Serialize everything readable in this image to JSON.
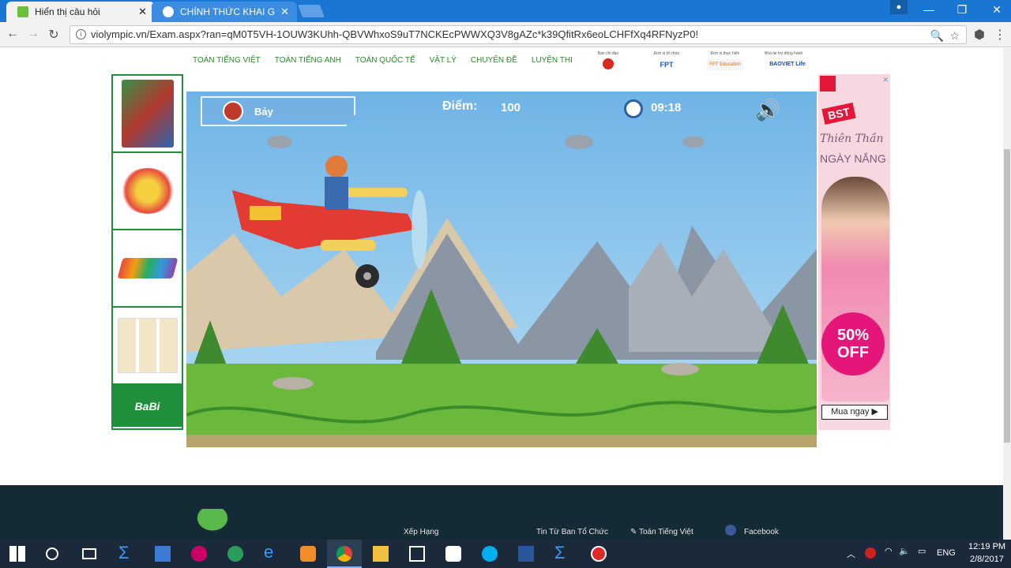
{
  "browser": {
    "tabs": [
      {
        "title": "Hiển thị câu hỏi",
        "active": true
      },
      {
        "title": "CHÍNH THỨC KHAI GIẢNG",
        "active": false
      }
    ],
    "url": "violympic.vn/Exam.aspx?ran=qM0T5VH-1OUW3KUhh-QBVWhxoS9uT7NCKEcPWWXQ3V8gAZc*k39QfitRx6eoLCHFfXq4RFNyzP0!"
  },
  "site": {
    "nav": [
      "TOÁN TIẾNG VIỆT",
      "TOÁN TIẾNG ANH",
      "TOÁN QUỐC TẾ",
      "VẬT LÝ",
      "CHUYÊN ĐỀ",
      "LUYỆN THI"
    ],
    "sponsors": [
      {
        "label": "Ban chỉ đạo"
      },
      {
        "label": "Đơn vị tổ chức",
        "logo": "FPT"
      },
      {
        "label": "Đơn vị thực hiện",
        "logo": "FPT Education"
      },
      {
        "label": "Nhà tài trợ đồng hành",
        "logo": "BAOVIET Life"
      }
    ]
  },
  "ads": {
    "left_brand": "BaBi",
    "right_lines": [
      "BST",
      "Thiên Thần",
      "NGÀY NẮNG"
    ],
    "right_discount": "50% OFF",
    "right_button": "Mua ngay ▶"
  },
  "game": {
    "player_name": "Bảy",
    "score_label": "Điểm:",
    "score_value": "100",
    "timer": "09:18"
  },
  "footer": {
    "links": [
      "Xếp Hạng",
      "Tin Từ Ban Tổ Chức",
      "✎ Toán Tiếng Việt",
      "Facebook"
    ]
  },
  "taskbar": {
    "language": "ENG",
    "time": "12:19 PM",
    "date": "2/8/2017"
  },
  "colors": {
    "tabbar": "#1976d2",
    "nav_green": "#2a8a2a",
    "ad_green": "#1f8f3c",
    "footer": "#142a34",
    "taskbar": "#1b2a3a"
  }
}
